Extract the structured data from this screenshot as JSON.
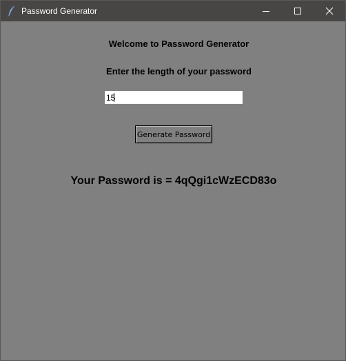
{
  "window": {
    "title": "Password Generator",
    "icon": "feather-icon",
    "controls": [
      "minimize-icon",
      "maximize-icon",
      "close-icon"
    ]
  },
  "form": {
    "welcome_text": "Welcome to Password Generator",
    "length_label": "Enter the length of your password",
    "length_value": "15",
    "generate_button_label": "Generate Password"
  },
  "result": {
    "text": "Your Password is = 4qQgi1cWzECD83o"
  },
  "colors": {
    "background": "#808080",
    "titlebar": "#484644",
    "input_background": "#ffffff",
    "text": "#000000"
  }
}
